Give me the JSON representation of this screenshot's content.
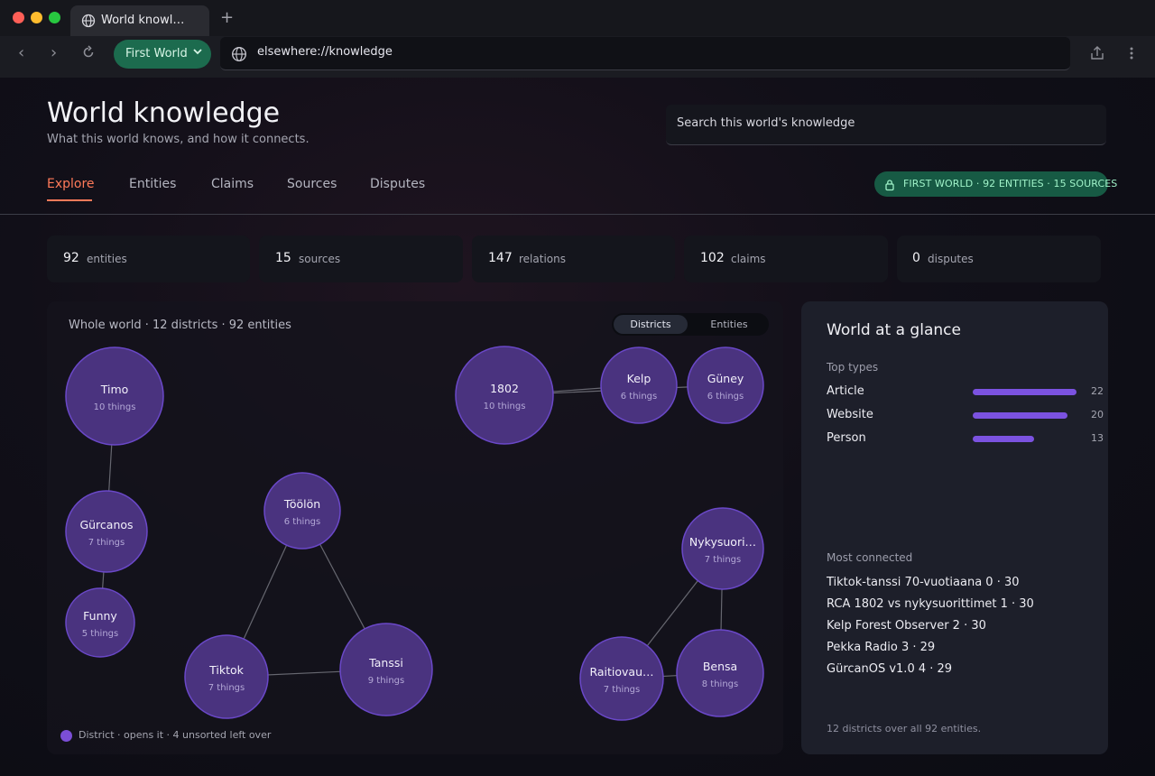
{
  "browser": {
    "tab_title": "World knowl…",
    "new_tab": "+",
    "profile_label": "First World",
    "url": "elsewhere://knowledge"
  },
  "header": {
    "title": "World knowledge",
    "subtitle": "What this world knows, and how it connects.",
    "search_placeholder": "Search this world's knowledge"
  },
  "tabs": [
    {
      "label": "Explore",
      "active": true
    },
    {
      "label": "Entities",
      "active": false
    },
    {
      "label": "Claims",
      "active": false
    },
    {
      "label": "Sources",
      "active": false
    },
    {
      "label": "Disputes",
      "active": false
    }
  ],
  "world_badge": "FIRST WORLD · 92 ENTITIES · 15 SOURCES",
  "stats": [
    {
      "value": "92",
      "label": "entities"
    },
    {
      "value": "15",
      "label": "sources"
    },
    {
      "value": "147",
      "label": "relations"
    },
    {
      "value": "102",
      "label": "claims"
    },
    {
      "value": "0",
      "label": "disputes"
    }
  ],
  "graph": {
    "caption": "Whole world · 12 districts · 92 entities",
    "view_toggle": [
      {
        "label": "Districts",
        "active": true
      },
      {
        "label": "Entities",
        "active": false
      }
    ],
    "districts": [
      {
        "name": "Timo",
        "count": "10 things"
      },
      {
        "name": "Gürcanos",
        "count": "7 things"
      },
      {
        "name": "Funny",
        "count": "5 things"
      },
      {
        "name": "Töölön",
        "count": "6 things"
      },
      {
        "name": "Tiktok",
        "count": "7 things"
      },
      {
        "name": "Tanssi",
        "count": "9 things"
      },
      {
        "name": "1802",
        "count": "10 things"
      },
      {
        "name": "Kelp",
        "count": "6 things"
      },
      {
        "name": "Güney",
        "count": "6 things"
      },
      {
        "name": "Nykysuori…",
        "count": "7 things"
      },
      {
        "name": "Raitiovau…",
        "count": "7 things"
      },
      {
        "name": "Bensa",
        "count": "8 things"
      }
    ],
    "legend": "District · opens it · 4 unsorted left over",
    "district_color": "#5a3b9a"
  },
  "glance": {
    "title": "World at a glance",
    "top_types_label": "Top types",
    "top_types": [
      {
        "name": "Article",
        "count": 22
      },
      {
        "name": "Website",
        "count": 20
      },
      {
        "name": "Person",
        "count": 13
      }
    ],
    "most_connected_label": "Most connected",
    "most_connected": [
      "Tiktok-tanssi 70-vuotiaana 0 · 30",
      "RCA 1802 vs nykysuorittimet 1 · 30",
      "Kelp Forest Observer 2 · 30",
      "Pekka Radio 3 · 29",
      "GürcanOS v1.0 4 · 29"
    ],
    "footer": "12 districts over all 92 entities."
  },
  "colors": {
    "accent": "#ff7a59",
    "badge_bg": "#175a44",
    "badge_text": "#9ff2c8",
    "bar": "#7b52e0",
    "node_fill": "#4a337f",
    "node_stroke": "#6a48c8"
  }
}
